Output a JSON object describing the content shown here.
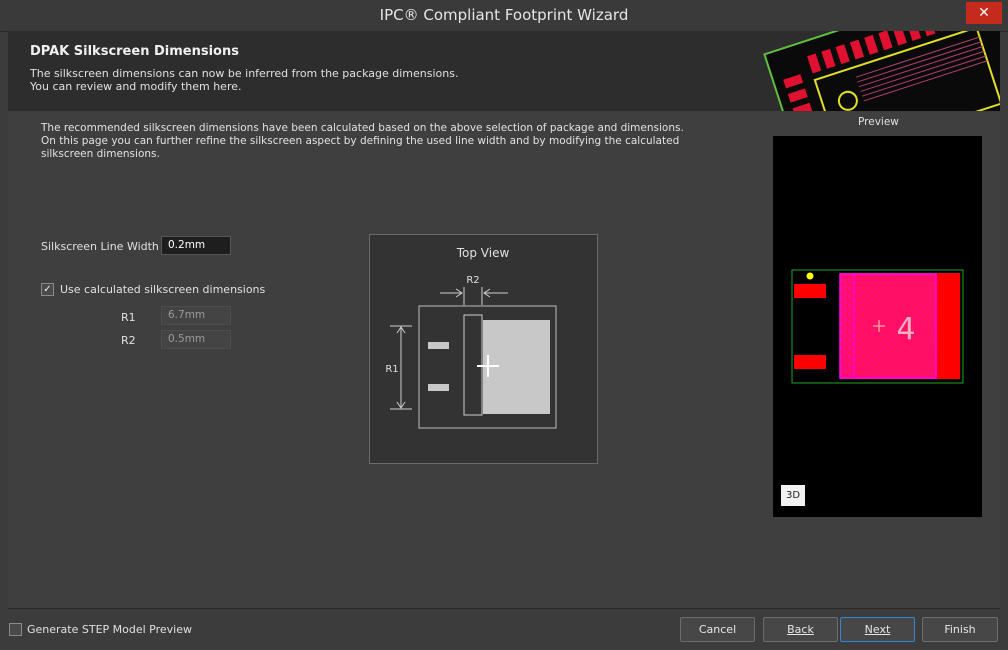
{
  "window": {
    "title": "IPC® Compliant Footprint Wizard",
    "close_glyph": "✕"
  },
  "header": {
    "title": "DPAK Silkscreen Dimensions",
    "desc_line1": "The silkscreen dimensions can now be inferred from the package dimensions.",
    "desc_line2": "You can review and modify them here."
  },
  "intro": "The recommended silkscreen dimensions have been calculated based on the above selection of package and dimensions. On this page you can further refine the silkscreen aspect by defining the used line width and by modifying the calculated silkscreen dimensions.",
  "form": {
    "line_width_label": "Silkscreen Line Width",
    "line_width_value": "0.2mm",
    "use_calc_label": "Use calculated silkscreen dimensions",
    "use_calc_checked": true,
    "r1_label": "R1",
    "r1_value": "6.7mm",
    "r2_label": "R2",
    "r2_value": "0.5mm"
  },
  "topview": {
    "title": "Top View",
    "r1": "R1",
    "r2": "R2"
  },
  "preview": {
    "label": "Preview",
    "pad_label": "4",
    "btn_3d": "3D"
  },
  "footer": {
    "step_label": "Generate STEP Model Preview",
    "step_checked": false,
    "cancel": "Cancel",
    "back": "Back",
    "next": "Next",
    "finish": "Finish"
  },
  "colors": {
    "pad": "#ff0000",
    "silk": "#ff00ff",
    "outline": "#1fa31f",
    "accent": "#2f86d6"
  }
}
